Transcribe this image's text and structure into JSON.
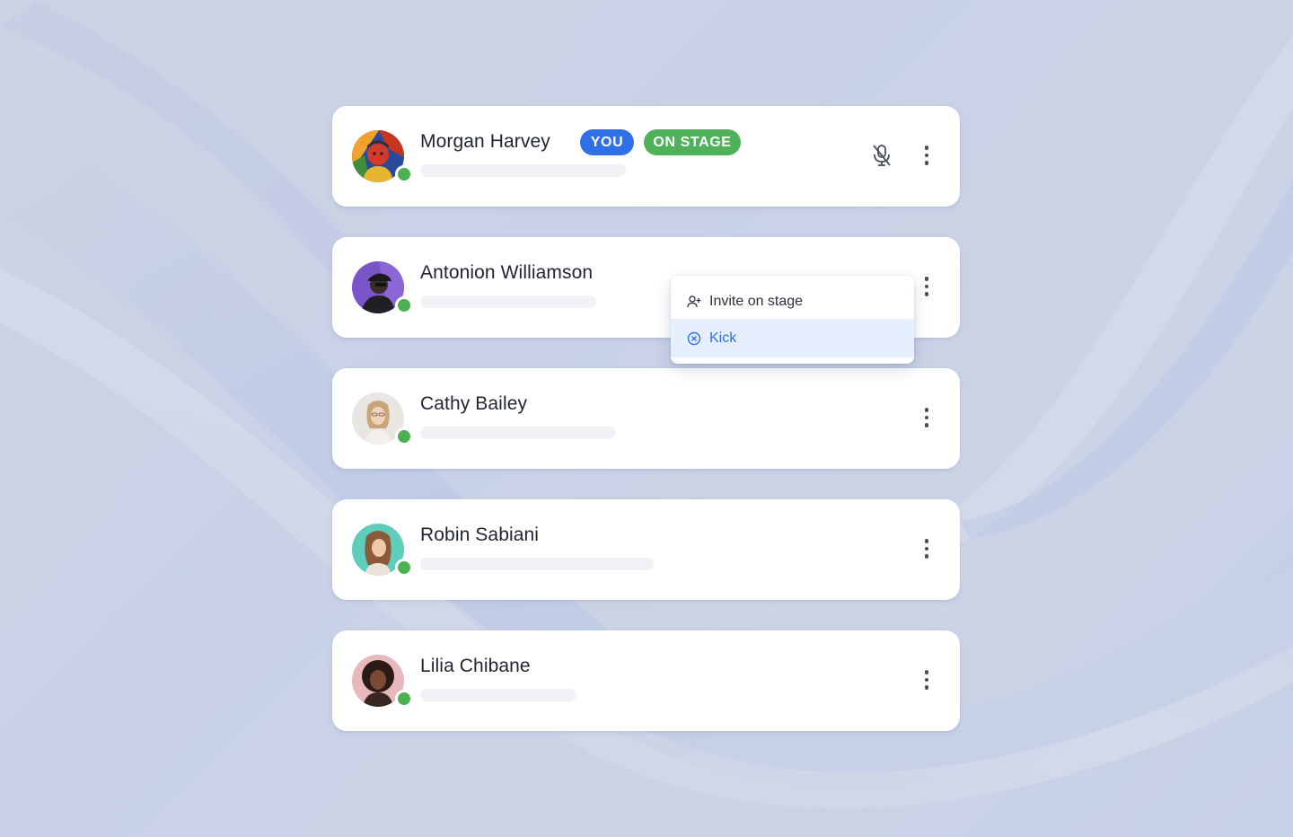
{
  "participants": [
    {
      "name": "Morgan Harvey",
      "badges": {
        "you": "YOU",
        "stage": "ON STAGE"
      },
      "online": true,
      "muted": true,
      "mic_icon": "mic-off-icon",
      "more_icon": "more-vertical-icon"
    },
    {
      "name": "Antonion Williamson",
      "online": true,
      "more_icon": "more-vertical-icon"
    },
    {
      "name": "Cathy Bailey",
      "online": true,
      "more_icon": "more-vertical-icon"
    },
    {
      "name": "Robin Sabiani",
      "online": true,
      "more_icon": "more-vertical-icon"
    },
    {
      "name": "Lilia Chibane",
      "online": true,
      "more_icon": "more-vertical-icon"
    }
  ],
  "context_menu": {
    "items": [
      {
        "label": "Invite on stage",
        "icon": "user-plus-icon"
      },
      {
        "label": "Kick",
        "icon": "x-circle-icon",
        "highlighted": true
      }
    ]
  },
  "colors": {
    "you_badge": "#2f6fe8",
    "stage_badge": "#4fb25a",
    "presence": "#4caf50",
    "kick_text": "#2f6fe8",
    "kick_highlight": "#e6effd"
  }
}
